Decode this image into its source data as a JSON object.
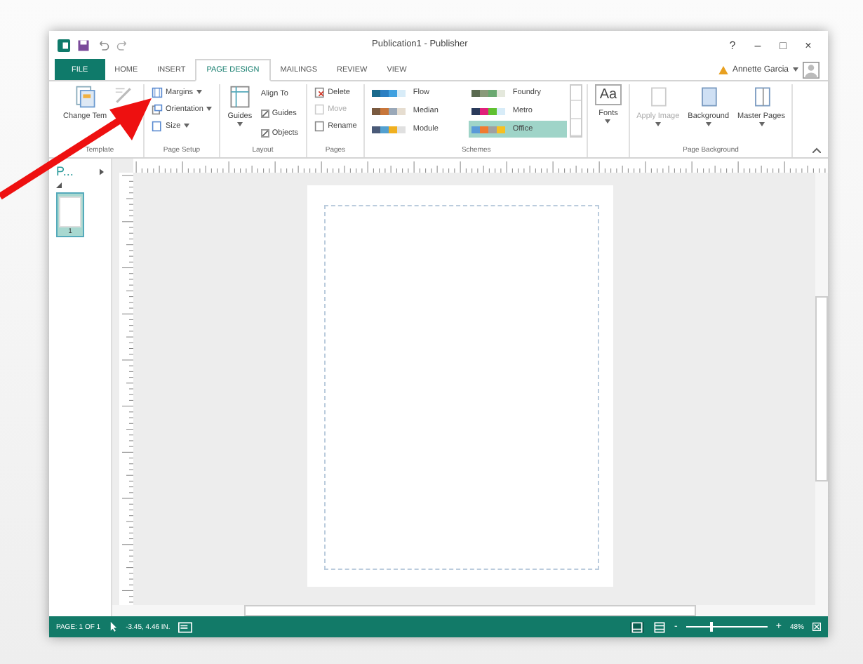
{
  "window": {
    "title": "Publication1 - Publisher",
    "controls": [
      "?",
      "–",
      "□",
      "×"
    ]
  },
  "tabs": [
    {
      "label": "FILE",
      "kind": "file",
      "selected": false
    },
    {
      "label": "HOME",
      "kind": "tab",
      "selected": false
    },
    {
      "label": "INSERT",
      "kind": "tab",
      "selected": false
    },
    {
      "label": "PAGE DESIGN",
      "kind": "tab",
      "selected": true
    },
    {
      "label": "MAILINGS",
      "kind": "tab",
      "selected": false
    },
    {
      "label": "REVIEW",
      "kind": "tab",
      "selected": false
    },
    {
      "label": "VIEW",
      "kind": "tab",
      "selected": false
    }
  ],
  "user": {
    "name": "Annette Garcia"
  },
  "ribbon": {
    "template": {
      "button": "Change Tem",
      "label": "Template"
    },
    "page_setup": {
      "items": [
        {
          "label": "Margins",
          "kind": "margins"
        },
        {
          "label": "Orientation",
          "kind": "orientation"
        },
        {
          "label": "Size",
          "kind": "size"
        }
      ],
      "label": "Page Setup"
    },
    "layout": {
      "guides": "Guides",
      "align_to": "Align To",
      "checks": [
        {
          "label": "Guides",
          "checked": true
        },
        {
          "label": "Objects",
          "checked": true
        }
      ],
      "label": "Layout"
    },
    "pages": {
      "items": [
        {
          "label": "Delete",
          "disabled": false
        },
        {
          "label": "Move",
          "disabled": true
        },
        {
          "label": "Rename",
          "disabled": false
        }
      ],
      "label": "Pages"
    },
    "schemes": {
      "items": [
        {
          "name": "Flow",
          "selected": false,
          "swatches": [
            {
              "color": "#1a6a8c"
            },
            {
              "color": "#2b7fc2"
            },
            {
              "color": "#3fa0e0"
            },
            {
              "color": "#d8ecf8"
            }
          ]
        },
        {
          "name": "Median",
          "selected": false,
          "swatches": [
            {
              "color": "#7a5a40"
            },
            {
              "color": "#c8763a"
            },
            {
              "color": "#9aa8b8"
            },
            {
              "color": "#e6ddd0"
            }
          ]
        },
        {
          "name": "Module",
          "selected": false,
          "swatches": [
            {
              "color": "#4a5a78"
            },
            {
              "color": "#52a0d0"
            },
            {
              "color": "#f0b020"
            },
            {
              "color": "#e0e0e0"
            }
          ]
        },
        {
          "name": "Foundry",
          "selected": false,
          "swatches": [
            {
              "color": "#5a6a50"
            },
            {
              "color": "#8a9a7a"
            },
            {
              "color": "#6aa870"
            },
            {
              "color": "#e4e8dc"
            }
          ]
        },
        {
          "name": "Metro",
          "selected": false,
          "swatches": [
            {
              "color": "#2a3a5a"
            },
            {
              "color": "#e0207a"
            },
            {
              "color": "#60c030"
            },
            {
              "color": "#d8ecf8"
            }
          ]
        },
        {
          "name": "Office",
          "selected": true,
          "swatches": [
            {
              "color": "#5a9ad8"
            },
            {
              "color": "#f07a30"
            },
            {
              "color": "#a0a0a0"
            },
            {
              "color": "#f8c020"
            }
          ]
        }
      ],
      "label": "Schemes"
    },
    "fonts": {
      "glyph": "Aa",
      "label": "Fonts"
    },
    "background": {
      "items": [
        {
          "label": "Apply Image",
          "disabled": true
        },
        {
          "label": "Background",
          "disabled": false
        },
        {
          "label": "Master Pages",
          "disabled": false
        }
      ],
      "label": "Page Background"
    }
  },
  "pages_pane": {
    "title": "P...",
    "thumbnails": [
      {
        "number": "1",
        "selected": true
      }
    ]
  },
  "status_bar": {
    "page": "PAGE: 1 OF 1",
    "position": "-3.45, 4.46 IN.",
    "zoom": {
      "out": "-",
      "in": "+",
      "level": 0.3,
      "reading": "48%"
    }
  }
}
